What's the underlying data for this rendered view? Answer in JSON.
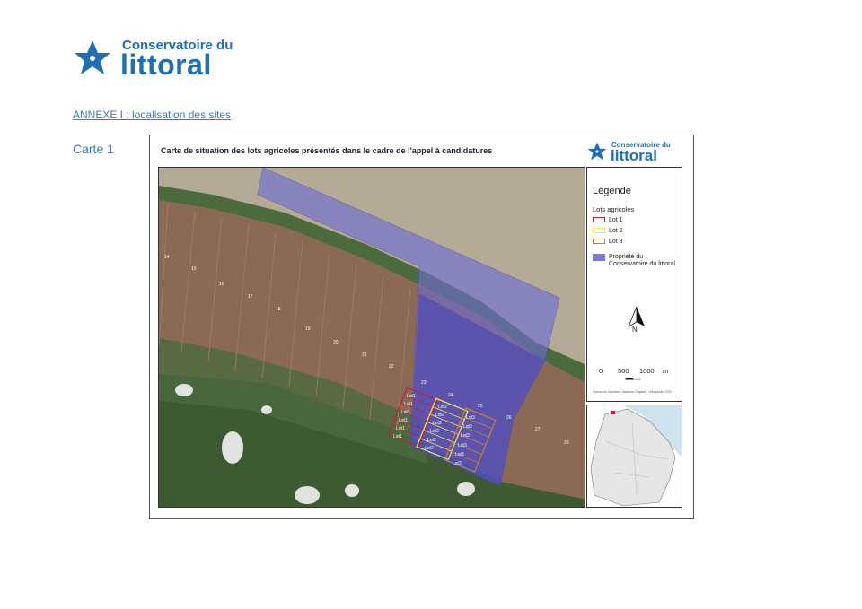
{
  "header": {
    "logo": {
      "line1": "Conservatoire du",
      "line2": "littoral"
    },
    "annex_title": "ANNEXE I : localisation des sites",
    "map_label": "Carte 1"
  },
  "map_frame": {
    "title": "Carte de situation des lots agricoles présentés dans le cadre de l'appel à candidatures",
    "logo": {
      "line1": "Conservatoire du",
      "line2": "littoral"
    }
  },
  "legend": {
    "title": "Légende",
    "subtitle": "Lots agricoles",
    "items": [
      {
        "label": "Lot 1",
        "color": "#c0203a"
      },
      {
        "label": "Lot 2",
        "color": "#f3e84a"
      },
      {
        "label": "Lot 3",
        "color": "#c9842a"
      }
    ],
    "property": {
      "label_line1": "Propriété du",
      "label_line2": "Conservatoire du littoral",
      "color": "#7b78d6"
    },
    "north_label": "N",
    "scale": {
      "labels": [
        "0",
        "500",
        "1000",
        "m"
      ]
    },
    "source": "Source du données : Antenne Guyane - orthophoto 2020"
  },
  "map": {
    "plot_numbers": [
      "14",
      "15",
      "16",
      "17",
      "18",
      "19",
      "20",
      "21",
      "22",
      "23",
      "24",
      "25",
      "26",
      "27",
      "28"
    ],
    "lot_labels": {
      "lot1": [
        "Lot1",
        "Lot1",
        "Lot1",
        "Lot1",
        "Lot1",
        "Lot1"
      ],
      "lot2": [
        "Lot2",
        "Lot2",
        "Lot2",
        "Lot2",
        "Lot2",
        "Lot2"
      ],
      "lot3": [
        "Lot3",
        "Lot3",
        "Lot3",
        "Lot3",
        "Lot3",
        "Lot3"
      ]
    }
  },
  "colors": {
    "brand": "#1f6fb5",
    "link": "#3b79b8",
    "sea": "#a8a08a",
    "fields": "#8a6a55",
    "forest": "#3e5a32"
  }
}
